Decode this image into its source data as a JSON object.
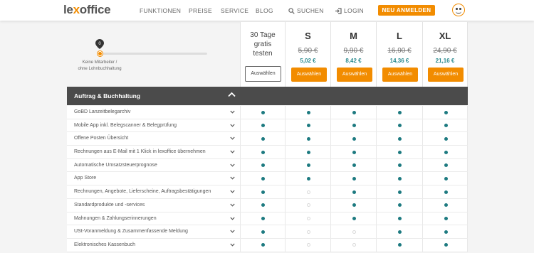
{
  "header": {
    "logo_lex": "le",
    "logo_x": "x",
    "logo_rest": "office",
    "nav": [
      "FUNKTIONEN",
      "PREISE",
      "SERVICE",
      "BLOG"
    ],
    "search_label": "SUCHEN",
    "login_label": "LOGIN",
    "cta_label": "NEU ANMELDEN"
  },
  "slider": {
    "value": "0",
    "caption_line1": "Keine Mitarbeiter /",
    "caption_line2": "ohne Lohnbuchhaltung"
  },
  "trial": {
    "line1": "30 Tage",
    "line2": "gratis",
    "line3": "testen",
    "button": "Auswählen"
  },
  "plans": [
    {
      "name": "S",
      "old_price": "5,90 €",
      "new_price": "5,02 €",
      "button": "Auswählen"
    },
    {
      "name": "M",
      "old_price": "9,90 €",
      "new_price": "8,42 €",
      "button": "Auswählen"
    },
    {
      "name": "L",
      "old_price": "16,90 €",
      "new_price": "14,36 €",
      "button": "Auswählen"
    },
    {
      "name": "XL",
      "old_price": "24,90 €",
      "new_price": "21,16 €",
      "button": "Auswählen"
    }
  ],
  "section": {
    "title": "Auftrag & Buchhaltung"
  },
  "colors": {
    "accent": "#f28c00",
    "check": "#1d7a80",
    "section_bg": "#4b4b4b"
  },
  "rows": [
    {
      "label": "GoBD Lanzeitbelegarchiv",
      "checks": [
        true,
        true,
        true,
        true,
        true
      ]
    },
    {
      "label": "Mobile App inkl. Belegscanner & Belegprüfung",
      "checks": [
        true,
        true,
        true,
        true,
        true
      ]
    },
    {
      "label": "Offene Posten Übersicht",
      "checks": [
        true,
        true,
        true,
        true,
        true
      ]
    },
    {
      "label": "Rechnungen aus E-Mail mit 1 Klick in lexoffice übernehmen",
      "checks": [
        true,
        true,
        true,
        true,
        true
      ]
    },
    {
      "label": "Automatische Umsatzsteuerprognose",
      "checks": [
        true,
        true,
        true,
        true,
        true
      ]
    },
    {
      "label": "App Store",
      "checks": [
        true,
        true,
        true,
        true,
        true
      ]
    },
    {
      "label": "Rechnungen, Angebote, Lieferscheine, Auftragsbestätigungen",
      "checks": [
        true,
        false,
        true,
        true,
        true
      ]
    },
    {
      "label": "Standardprodukte und -services",
      "checks": [
        true,
        false,
        true,
        true,
        true
      ]
    },
    {
      "label": "Mahnungen & Zahlungserinnerungen",
      "checks": [
        true,
        false,
        true,
        true,
        true
      ]
    },
    {
      "label": "USt-Voranmeldung & Zusammenfassende Meldung",
      "checks": [
        true,
        false,
        false,
        true,
        true
      ]
    },
    {
      "label": "Elektronisches Kassenbuch",
      "checks": [
        true,
        false,
        false,
        true,
        true
      ]
    }
  ]
}
